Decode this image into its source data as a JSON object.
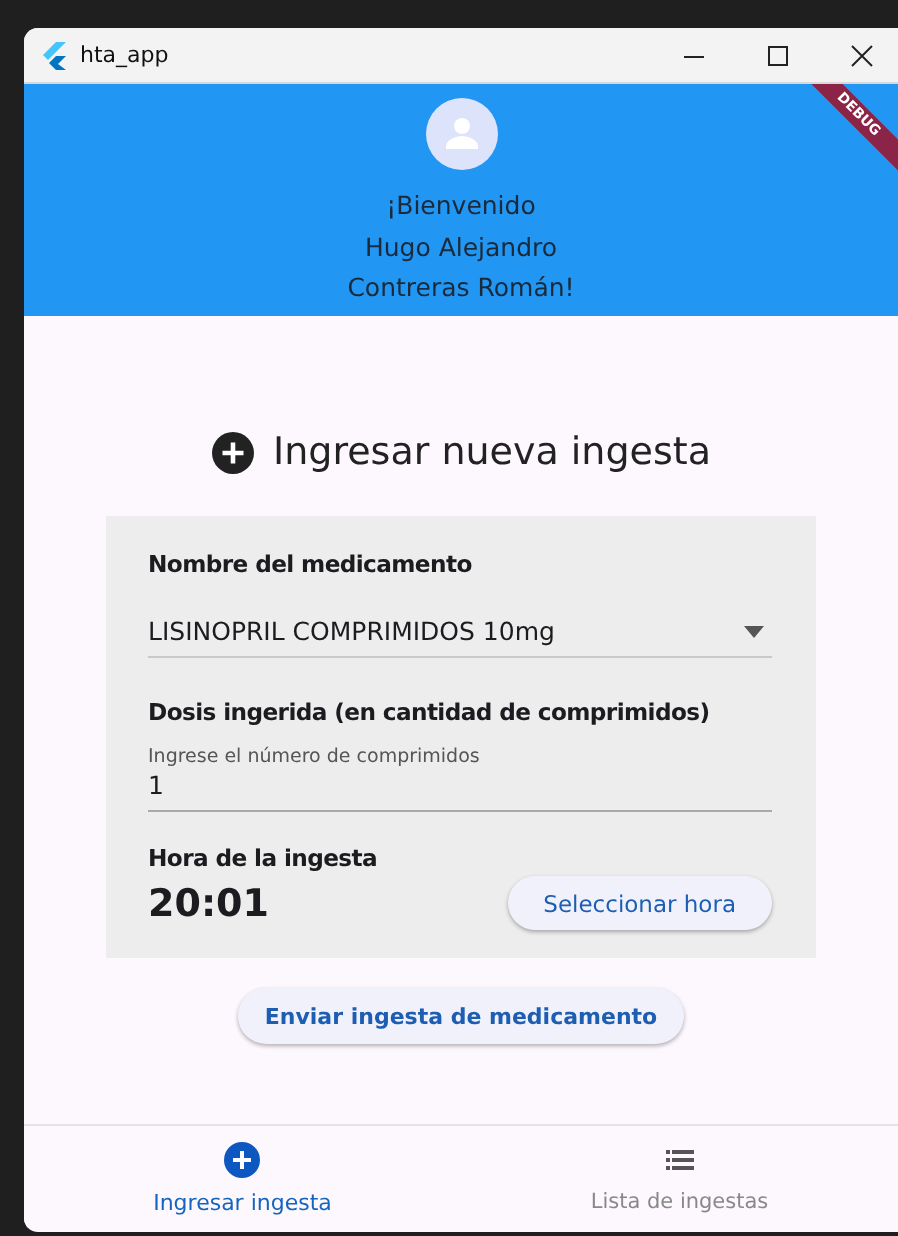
{
  "window": {
    "title": "hta_app"
  },
  "header": {
    "greeting": [
      "¡Bienvenido",
      "Hugo Alejandro",
      "Contreras Román!"
    ],
    "debug_banner": "DEBUG"
  },
  "form": {
    "title": "Ingresar nueva ingesta",
    "medication_label": "Nombre del medicamento",
    "medication_value": "LISINOPRIL COMPRIMIDOS 10mg",
    "dose_label": "Dosis ingerida (en cantidad de comprimidos)",
    "dose_field": {
      "label": "Ingrese el número de comprimidos",
      "value": "1"
    },
    "time_label": "Hora de la ingesta",
    "time_value": "20:01",
    "time_button": "Seleccionar hora",
    "submit_button": "Enviar ingesta de medicamento"
  },
  "bottom_nav": [
    {
      "kind": "add",
      "label": "Ingresar ingesta",
      "selected": true
    },
    {
      "kind": "list",
      "label": "Lista de ingestas",
      "selected": false
    }
  ]
}
